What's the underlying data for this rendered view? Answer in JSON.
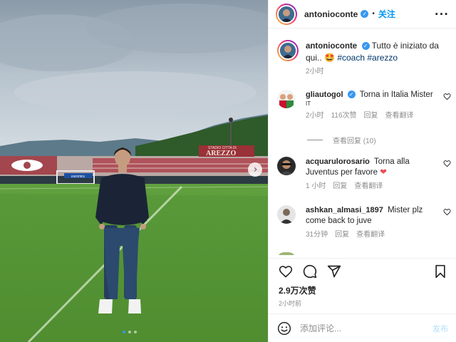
{
  "photo": {
    "stadium_sign_top": "STADIO CITTA DI",
    "stadium_sign_main": "AREZZO",
    "goal_board_text": "euronics",
    "next_icon": "chevron-right-icon",
    "carousel": {
      "count": 3,
      "active": 1
    }
  },
  "header": {
    "username": "antonioconte",
    "verified_mark": "✓",
    "follow_label": "关注",
    "more_label": "···"
  },
  "caption": {
    "username": "antonioconte",
    "verified_mark": "✓",
    "text": "Tutto è iniziato da qui..",
    "emoji": "🤩",
    "hashtags": "#coach #arezzo",
    "time": "2小时"
  },
  "comments": [
    {
      "username": "gliautogol",
      "verified_mark": "✓",
      "text": "Torna in Italia Mister",
      "flag": "IT",
      "time": "2小时",
      "likes": "116次赞",
      "reply": "回复",
      "translate": "查看翻译",
      "view_replies": "查看回复 (10)"
    },
    {
      "username": "acquarulorosario",
      "text": "Torna alla Juventus per favore",
      "heart": "❤",
      "time": "1 小时",
      "reply": "回复",
      "translate": "查看翻译"
    },
    {
      "username": "ashkan_almasi_1897",
      "text": "Mister plz come back to juve",
      "time": "31分钟",
      "reply": "回复",
      "translate": "查看翻译"
    }
  ],
  "actions": {
    "likes": "2.9万次赞",
    "posted": "2小时前"
  },
  "add_comment": {
    "placeholder": "添加评论...",
    "post_label": "发布"
  },
  "colors": {
    "accent": "#0095f6",
    "verified": "#3897f0",
    "muted_text": "#8e8e8e",
    "heart_red": "#ed4956"
  }
}
